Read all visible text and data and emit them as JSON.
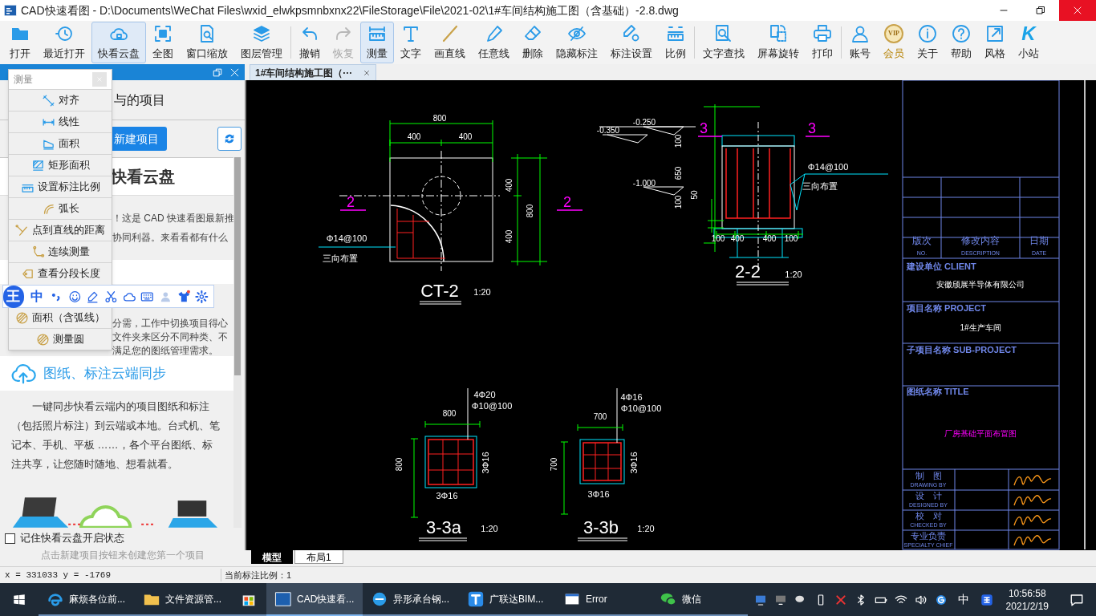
{
  "window": {
    "title": "CAD快速看图 - D:\\Documents\\WeChat Files\\wxid_elwkpsmnbxnx22\\FileStorage\\File\\2021-02\\1#车间结构施工图（含基础）-2.8.dwg"
  },
  "toolbar": {
    "groups": [
      [
        {
          "label": "打开",
          "kind": "tool",
          "selected": false,
          "disabled": false
        },
        {
          "label": "最近打开",
          "kind": "tool",
          "selected": false,
          "disabled": false
        },
        {
          "label": "快看云盘",
          "kind": "tool",
          "selected": true,
          "disabled": false
        },
        {
          "label": "全图",
          "kind": "tool",
          "selected": false,
          "disabled": false
        },
        {
          "label": "窗口缩放",
          "kind": "tool",
          "selected": false,
          "disabled": false
        },
        {
          "label": "图层管理",
          "kind": "tool",
          "selected": false,
          "disabled": false
        }
      ],
      [
        {
          "label": "撤销",
          "kind": "tool",
          "selected": false,
          "disabled": false
        },
        {
          "label": "恢复",
          "kind": "tool",
          "selected": false,
          "disabled": true
        },
        {
          "label": "测量",
          "kind": "tool",
          "selected": true,
          "disabled": false
        },
        {
          "label": "文字",
          "kind": "tool",
          "selected": false,
          "disabled": false
        },
        {
          "label": "画直线",
          "kind": "tool",
          "selected": false,
          "disabled": false
        },
        {
          "label": "任意线",
          "kind": "tool",
          "selected": false,
          "disabled": false
        },
        {
          "label": "删除",
          "kind": "tool",
          "selected": false,
          "disabled": false
        },
        {
          "label": "隐藏标注",
          "kind": "tool",
          "selected": false,
          "disabled": false
        },
        {
          "label": "标注设置",
          "kind": "tool",
          "selected": false,
          "disabled": false
        },
        {
          "label": "比例",
          "kind": "tool",
          "selected": false,
          "disabled": false
        }
      ],
      [
        {
          "label": "文字查找",
          "kind": "tool",
          "selected": false,
          "disabled": false
        },
        {
          "label": "屏幕旋转",
          "kind": "tool",
          "selected": false,
          "disabled": false
        },
        {
          "label": "打印",
          "kind": "tool",
          "selected": false,
          "disabled": false
        }
      ],
      [
        {
          "label": "账号",
          "kind": "tool",
          "selected": false,
          "disabled": false
        },
        {
          "label": "会员",
          "kind": "vip",
          "badge": "VIP",
          "selected": false,
          "disabled": false
        },
        {
          "label": "关于",
          "kind": "tool",
          "selected": false,
          "disabled": false
        },
        {
          "label": "帮助",
          "kind": "tool",
          "selected": false,
          "disabled": false
        },
        {
          "label": "风格",
          "kind": "tool",
          "selected": false,
          "disabled": false
        },
        {
          "label": "小站",
          "kind": "logo",
          "logo": "K",
          "selected": false,
          "disabled": false
        }
      ]
    ]
  },
  "panel": {
    "heading": "与的项目",
    "new_button": "新建项目",
    "card_title": "快看云盘",
    "intro_lines": [
      "！这是 CAD 快速看图最新推",
      "协同利器。来看看都有什么"
    ],
    "feature_lines": [
      "分需，工作中切换项目得心",
      "文件夹来区分不同种类、不",
      "满足您的图纸管理需求。"
    ],
    "sync_title": "图纸、标注云端同步",
    "sync_text": "一键同步快看云端内的项目图纸和标注（包括照片标注）到云端或本地。台式机、笔记本、手机、平板 ……，各个平台图纸、标注共享，让您随时随地、想看就看。",
    "remember": {
      "label": "记住快看云盘开启状态",
      "checked": false
    },
    "hint": "点击新建项目按钮来创建您第一个项目"
  },
  "measure_menu": {
    "title": "测量",
    "items": [
      "对齐",
      "线性",
      "面积",
      "矩形面积",
      "设置标注比例",
      "弧长",
      "点到直线的距离",
      "连续测量",
      "查看分段长度",
      "面积（含弧线）",
      "测量圆"
    ]
  },
  "ime_bar": {
    "logo": "王",
    "mode": "中"
  },
  "document_tab": {
    "label": "1#车间结构施工图（···"
  },
  "drawing": {
    "labels": [
      {
        "text": "800",
        "kind": "dim"
      },
      {
        "text": "400",
        "kind": "dim"
      },
      {
        "text": "400",
        "kind": "dim"
      },
      {
        "text": "400",
        "kind": "dim"
      },
      {
        "text": "400",
        "kind": "dim"
      },
      {
        "text": "800",
        "kind": "dim"
      },
      {
        "text": "2",
        "kind": "mark"
      },
      {
        "text": "2",
        "kind": "mark"
      },
      {
        "text": "Φ14@100",
        "kind": "note"
      },
      {
        "text": "三向布置",
        "kind": "note"
      },
      {
        "text": "CT-2",
        "kind": "title"
      },
      {
        "text": "1:20",
        "kind": "note"
      },
      {
        "text": "-0.350",
        "kind": "dim"
      },
      {
        "text": "-0.250",
        "kind": "dim"
      },
      {
        "text": "-1.000",
        "kind": "dim"
      },
      {
        "text": "100",
        "kind": "dim"
      },
      {
        "text": "650",
        "kind": "dim"
      },
      {
        "text": "50",
        "kind": "dim"
      },
      {
        "text": "100",
        "kind": "dim"
      },
      {
        "text": "3",
        "kind": "mark"
      },
      {
        "text": "3",
        "kind": "mark"
      },
      {
        "text": "Φ14@100",
        "kind": "note"
      },
      {
        "text": "三向布置",
        "kind": "note"
      },
      {
        "text": "100",
        "kind": "dim"
      },
      {
        "text": "400",
        "kind": "dim"
      },
      {
        "text": "400",
        "kind": "dim"
      },
      {
        "text": "100",
        "kind": "dim"
      },
      {
        "text": "2-2",
        "kind": "title"
      },
      {
        "text": "1:20",
        "kind": "note"
      },
      {
        "text": "4Φ20",
        "kind": "note"
      },
      {
        "text": "Φ10@100",
        "kind": "note"
      },
      {
        "text": "800",
        "kind": "dim"
      },
      {
        "text": "800",
        "kind": "dim"
      },
      {
        "text": "3Φ16",
        "kind": "note"
      },
      {
        "text": "3Φ16",
        "kind": "note"
      },
      {
        "text": "3-3a",
        "kind": "title"
      },
      {
        "text": "1:20",
        "kind": "note"
      },
      {
        "text": "4Φ16",
        "kind": "note"
      },
      {
        "text": "Φ10@100",
        "kind": "note"
      },
      {
        "text": "700",
        "kind": "dim"
      },
      {
        "text": "700",
        "kind": "dim"
      },
      {
        "text": "3Φ16",
        "kind": "note"
      },
      {
        "text": "3Φ16",
        "kind": "note"
      },
      {
        "text": "3-3b",
        "kind": "title"
      },
      {
        "text": "1:20",
        "kind": "note"
      }
    ],
    "title_block": {
      "revision_header": [
        {
          "zh": "版次",
          "en": "NO."
        },
        {
          "zh": "修改内容",
          "en": "DESCRIPTION"
        },
        {
          "zh": "日期",
          "en": "DATE"
        }
      ],
      "fields": [
        {
          "label": "建设单位 CLIENT",
          "value": "安徽颀展半导体有限公司"
        },
        {
          "label": "项目名称 PROJECT",
          "value": "1#生产车间"
        },
        {
          "label": "子项目名称 SUB-PROJECT"
        },
        {
          "label": "图纸名称 TITLE",
          "value": "厂房基础平面布置图"
        }
      ],
      "sign_rows": [
        {
          "zh": "制　图",
          "en": "DRAWING BY"
        },
        {
          "zh": "设　计",
          "en": "DESIGNED BY"
        },
        {
          "zh": "校　对",
          "en": "CHECKED BY"
        },
        {
          "zh": "专业负责",
          "en": "SPECIALTY CHIEF"
        }
      ]
    }
  },
  "layout_tabs": [
    {
      "label": "模型",
      "selected": true
    },
    {
      "label": "布局1",
      "selected": false
    }
  ],
  "status_bar": {
    "coordinates": "x = 331033 y = -1769",
    "annotation_scale": "当前标注比例：1"
  },
  "taskbar": {
    "items": [
      {
        "label": "麻烦各位前...",
        "kind": "edge",
        "active": false
      },
      {
        "label": "文件资源管...",
        "kind": "folder",
        "active": false
      },
      {
        "kind": "store",
        "active": false
      },
      {
        "label": "CAD快速看...",
        "kind": "cad",
        "active": true
      },
      {
        "label": "异形承台钢...",
        "kind": "ie",
        "active": false
      },
      {
        "label": "广联达BIM...",
        "kind": "glodon",
        "active": false
      },
      {
        "label": "Error",
        "kind": "window",
        "active": false
      },
      {
        "label": "微信",
        "kind": "wechat",
        "active": false
      }
    ],
    "tray": {
      "ime": "中",
      "time": "10:56:58",
      "date": "2021/2/19"
    }
  }
}
